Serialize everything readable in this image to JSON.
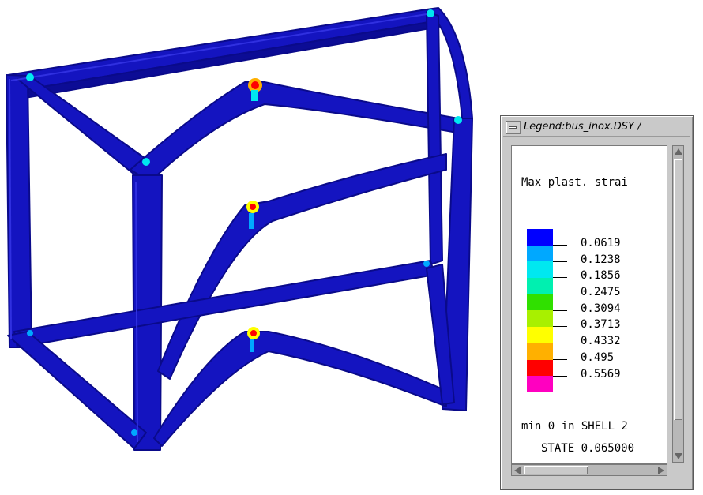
{
  "legend": {
    "window_title": "Legend:bus_inox.DSY /",
    "heading": "Max plast. strai",
    "scale": [
      {
        "value": "0.0619",
        "color": "#0000ff"
      },
      {
        "value": "0.1238",
        "color": "#00a8ff"
      },
      {
        "value": "0.1856",
        "color": "#00e8f0"
      },
      {
        "value": "0.2475",
        "color": "#00f0b0"
      },
      {
        "value": "0.3094",
        "color": "#30e000"
      },
      {
        "value": "0.3713",
        "color": "#a8f000"
      },
      {
        "value": "0.4332",
        "color": "#ffff00"
      },
      {
        "value": "0.495",
        "color": "#ffb000"
      },
      {
        "value": "0.5569",
        "color": "#ff0000"
      },
      {
        "value": "",
        "color": "#ff00c0"
      }
    ],
    "min_text": "min 0 in SHELL 2",
    "state_text": "STATE 0.065000"
  },
  "colors": {
    "frame": "#1414c0",
    "frame_dark": "#0a0a8a",
    "frame_shade": "#0c0c95",
    "window_bg": "#c9c9c9"
  }
}
